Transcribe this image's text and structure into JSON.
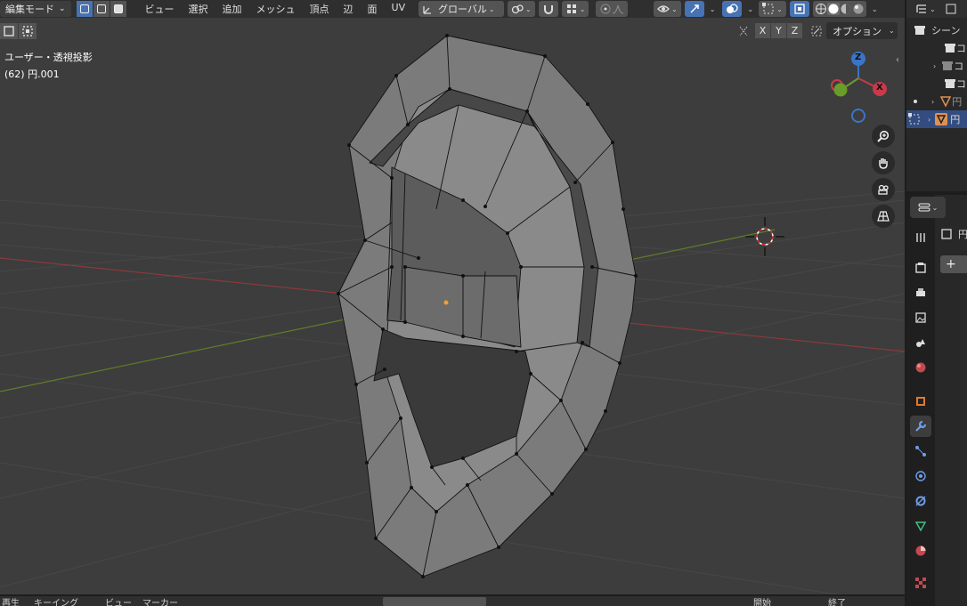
{
  "header": {
    "mode": "編集モード",
    "menu": [
      "ビュー",
      "選択",
      "追加",
      "メッシュ",
      "頂点",
      "辺",
      "面",
      "UV"
    ],
    "transform_orientation": "グローバル"
  },
  "viewport": {
    "view_title": "ユーザー・透視投影",
    "object_info": "(62) 円.001",
    "axis_x": "X",
    "axis_y": "Y",
    "axis_z": "Z",
    "options_label": "オプション",
    "gizmo": {
      "x": "X",
      "y": "Y",
      "z": "Z"
    }
  },
  "outliner": {
    "rows": [
      {
        "label": "シーン"
      },
      {
        "label": "コ"
      },
      {
        "label": "コ"
      },
      {
        "label": "コ"
      },
      {
        "label": "円"
      },
      {
        "label": "円"
      }
    ]
  },
  "properties": {
    "object_name": "円",
    "add_label": "+"
  },
  "timeline": {
    "items": [
      "再生",
      "キーイング",
      "ビュー",
      "マーカー"
    ],
    "fields": [
      "開始",
      "終了"
    ]
  },
  "colors": {
    "accent": "#4772b3",
    "axis_x_line": "#8a3a3a",
    "axis_y_line": "#5f7d2a",
    "mesh_face": "#7c7c7c",
    "mesh_edge": "#111111"
  }
}
